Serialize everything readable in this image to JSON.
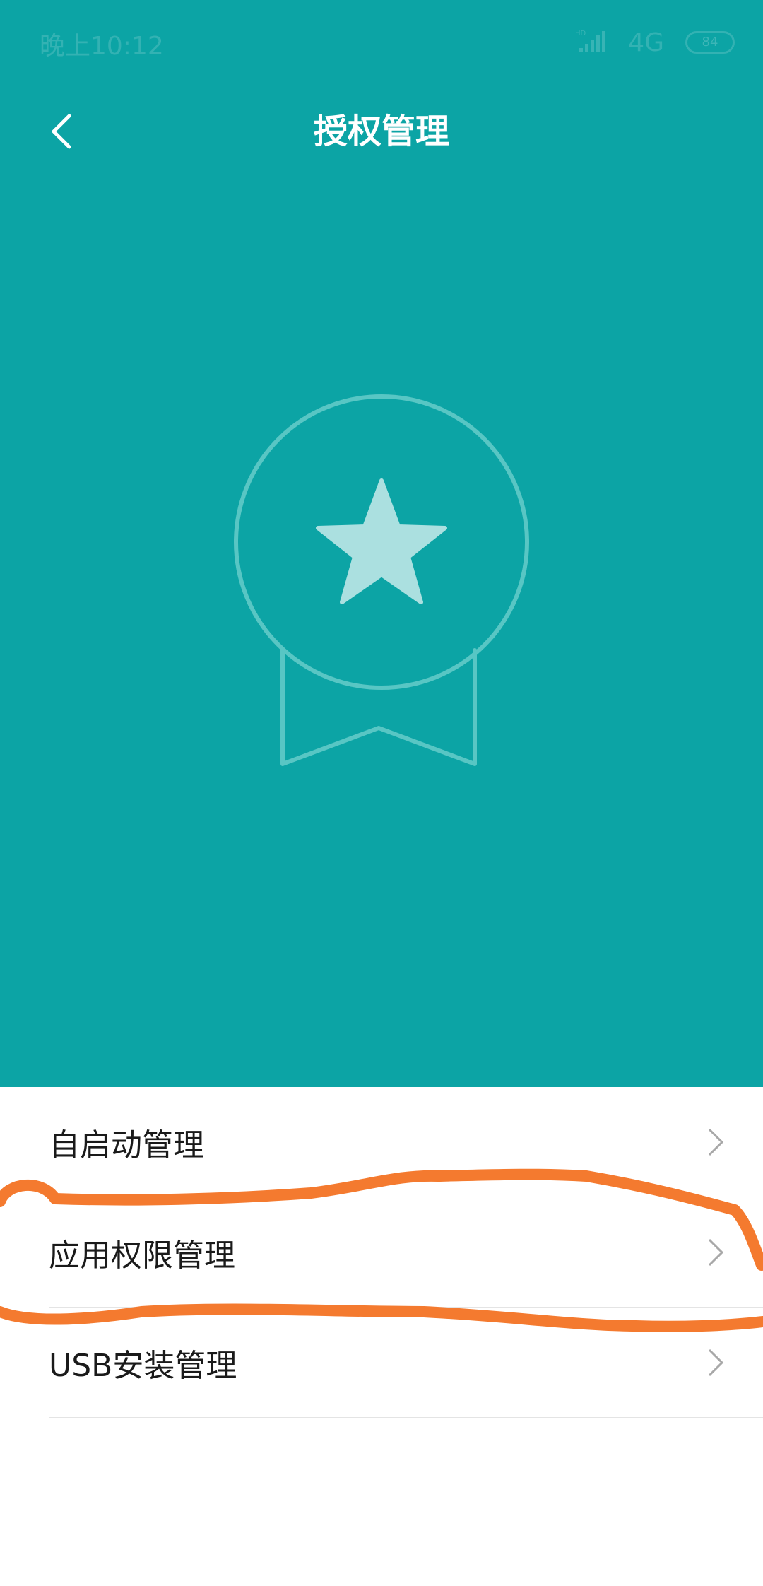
{
  "status_bar": {
    "time": "晚上10:12",
    "network": "4G",
    "hd_label": "HD",
    "battery": "84"
  },
  "header": {
    "back_icon": "chevron-left-icon",
    "title": "授权管理"
  },
  "hero": {
    "background_color": "#0ca4a5",
    "illustration_icon": "medal-star-icon"
  },
  "menu": {
    "items": [
      {
        "label": "自启动管理",
        "icon": "chevron-right-icon"
      },
      {
        "label": "应用权限管理",
        "icon": "chevron-right-icon",
        "highlighted": true
      },
      {
        "label": "USB安装管理",
        "icon": "chevron-right-icon"
      }
    ]
  },
  "annotation": {
    "color": "#f47a2f",
    "target": "应用权限管理"
  }
}
